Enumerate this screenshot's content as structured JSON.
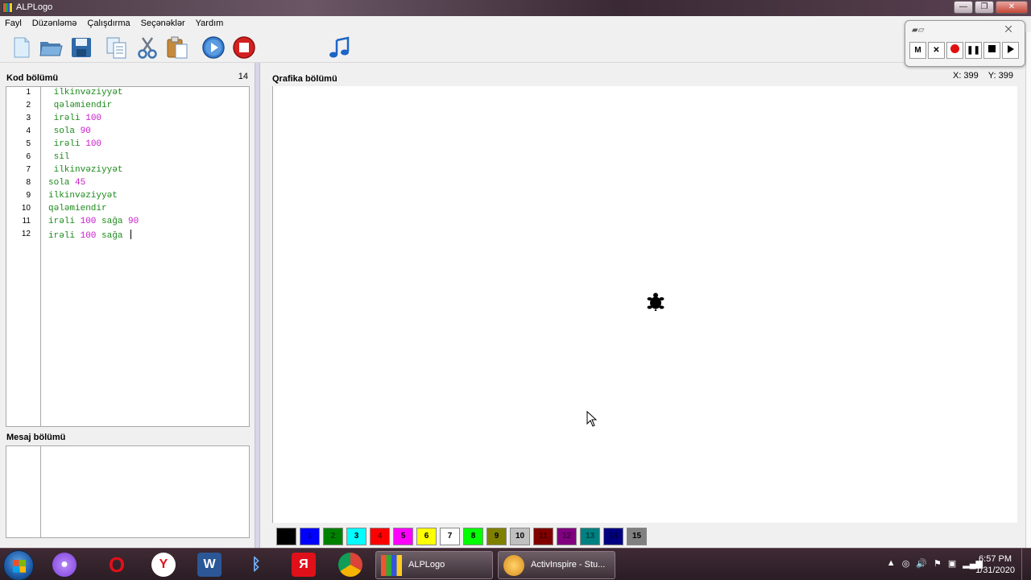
{
  "window": {
    "title": "ALPLogo",
    "minimize": "—",
    "maximize": "❐",
    "close": "✕"
  },
  "menu": [
    "Fayl",
    "Düzənləmə",
    "Çalışdırma",
    "Seçənəklər",
    "Yardım"
  ],
  "toolbar": [
    "new-file-icon",
    "open-folder-icon",
    "save-icon",
    "copy-icon",
    "cut-icon",
    "paste-icon",
    "run-icon",
    "stop-icon",
    "music-icon"
  ],
  "code_panel": {
    "label": "Kod bölümü",
    "line_count": "14",
    "lines": [
      {
        "n": "1",
        "indent": " ",
        "parts": [
          {
            "t": "ilkinvəziyyət",
            "c": "kw"
          }
        ]
      },
      {
        "n": "2",
        "indent": " ",
        "parts": [
          {
            "t": "qələmiendir",
            "c": "kw"
          }
        ]
      },
      {
        "n": "3",
        "indent": " ",
        "parts": [
          {
            "t": "irəli ",
            "c": "kw"
          },
          {
            "t": "100",
            "c": "num"
          }
        ]
      },
      {
        "n": "4",
        "indent": " ",
        "parts": [
          {
            "t": "sola ",
            "c": "kw"
          },
          {
            "t": "90",
            "c": "num"
          }
        ]
      },
      {
        "n": "5",
        "indent": " ",
        "parts": [
          {
            "t": "irəli ",
            "c": "kw"
          },
          {
            "t": "100",
            "c": "num"
          }
        ]
      },
      {
        "n": "6",
        "indent": " ",
        "parts": [
          {
            "t": "sil",
            "c": "kw"
          }
        ]
      },
      {
        "n": "7",
        "indent": " ",
        "parts": [
          {
            "t": "ilkinvəziyyət",
            "c": "kw"
          }
        ]
      },
      {
        "n": "8",
        "indent": "",
        "parts": [
          {
            "t": "sola ",
            "c": "kw"
          },
          {
            "t": "45",
            "c": "num"
          }
        ]
      },
      {
        "n": "9",
        "indent": "",
        "parts": [
          {
            "t": "ilkinvəziyyət",
            "c": "kw"
          }
        ]
      },
      {
        "n": "10",
        "indent": "",
        "parts": [
          {
            "t": "qələmiendir",
            "c": "kw"
          }
        ]
      },
      {
        "n": "11",
        "indent": "",
        "parts": [
          {
            "t": "irəli ",
            "c": "kw"
          },
          {
            "t": "100 ",
            "c": "num"
          },
          {
            "t": "sağa ",
            "c": "kw"
          },
          {
            "t": "90",
            "c": "num"
          }
        ]
      },
      {
        "n": "12",
        "indent": "",
        "parts": [
          {
            "t": "irəli ",
            "c": "kw"
          },
          {
            "t": "100 ",
            "c": "num"
          },
          {
            "t": "sağa ",
            "c": "kw"
          }
        ],
        "caret": true
      }
    ]
  },
  "message_panel": {
    "label": "Mesaj bölümü"
  },
  "graphics_panel": {
    "label": "Qrafika bölümü",
    "x_label": "X: 399",
    "y_label": "Y: 399"
  },
  "palette": [
    {
      "label": "",
      "bg": "#000000",
      "fg": "#000000"
    },
    {
      "label": "1",
      "bg": "#0000ff",
      "fg": "#000080"
    },
    {
      "label": "2",
      "bg": "#008000",
      "fg": "#004000"
    },
    {
      "label": "3",
      "bg": "#00ffff",
      "fg": "#000000"
    },
    {
      "label": "4",
      "bg": "#ff0000",
      "fg": "#800000"
    },
    {
      "label": "5",
      "bg": "#ff00ff",
      "fg": "#000000"
    },
    {
      "label": "6",
      "bg": "#ffff00",
      "fg": "#000000"
    },
    {
      "label": "7",
      "bg": "#ffffff",
      "fg": "#000000"
    },
    {
      "label": "8",
      "bg": "#00ff00",
      "fg": "#000000"
    },
    {
      "label": "9",
      "bg": "#808000",
      "fg": "#000000"
    },
    {
      "label": "10",
      "bg": "#c0c0c0",
      "fg": "#000000"
    },
    {
      "label": "11",
      "bg": "#800000",
      "fg": "#400000"
    },
    {
      "label": "12",
      "bg": "#800080",
      "fg": "#400040"
    },
    {
      "label": "13",
      "bg": "#008080",
      "fg": "#004040"
    },
    {
      "label": "14",
      "bg": "#000080",
      "fg": "#000040"
    },
    {
      "label": "15",
      "bg": "#808080",
      "fg": "#000000"
    }
  ],
  "recorder": {
    "buttons": [
      "M",
      "✕",
      "record",
      "❚❚",
      "stop",
      "play"
    ],
    "close": "⨉"
  },
  "taskbar": {
    "tasks": [
      {
        "label": "ALPLogo"
      },
      {
        "label": "ActivInspire - Stu..."
      }
    ],
    "time": "6:57 PM",
    "date": "1/31/2020"
  }
}
